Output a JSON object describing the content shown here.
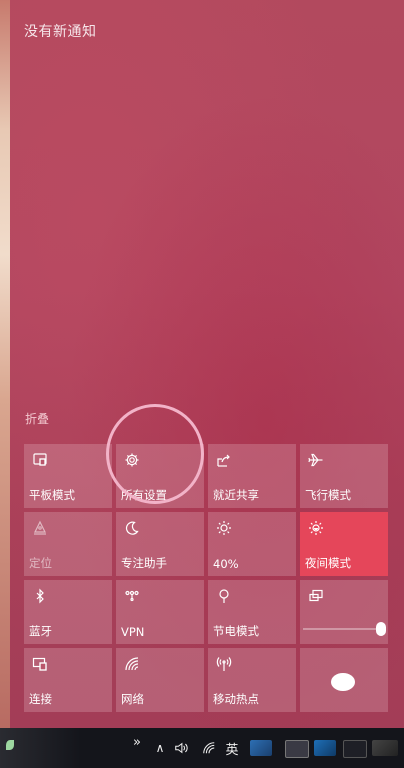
{
  "action_center": {
    "no_notifications": "没有新通知",
    "collapse": "折叠"
  },
  "tiles": [
    {
      "label": "平板模式",
      "icon": "tablet-mode-icon",
      "state": "off"
    },
    {
      "label": "所有设置",
      "icon": "gear-icon",
      "state": "off"
    },
    {
      "label": "就近共享",
      "icon": "nearby-share-icon",
      "state": "off"
    },
    {
      "label": "飞行模式",
      "icon": "airplane-icon",
      "state": "off"
    },
    {
      "label": "定位",
      "icon": "location-icon",
      "state": "disabled"
    },
    {
      "label": "专注助手",
      "icon": "moon-icon",
      "state": "off"
    },
    {
      "label": "40%",
      "icon": "brightness-icon",
      "state": "off"
    },
    {
      "label": "夜间模式",
      "icon": "night-light-icon",
      "state": "on"
    },
    {
      "label": "蓝牙",
      "icon": "bluetooth-icon",
      "state": "off"
    },
    {
      "label": "VPN",
      "icon": "vpn-icon",
      "state": "off"
    },
    {
      "label": "节电模式",
      "icon": "battery-saver-icon",
      "state": "off"
    },
    {
      "label": "",
      "icon": "project-icon",
      "state": "off"
    },
    {
      "label": "连接",
      "icon": "connect-icon",
      "state": "off"
    },
    {
      "label": "网络",
      "icon": "network-icon",
      "state": "off"
    },
    {
      "label": "移动热点",
      "icon": "hotspot-icon",
      "state": "off"
    },
    {
      "label": "",
      "icon": "",
      "state": "off"
    }
  ],
  "taskbar": {
    "chevron": "»",
    "show_hidden": "∧",
    "ime": "英"
  },
  "colors": {
    "panel": "#b2495e",
    "active_tile": "#e5465a",
    "taskbar": "#14151b",
    "highlight": "#f2b3c8"
  }
}
